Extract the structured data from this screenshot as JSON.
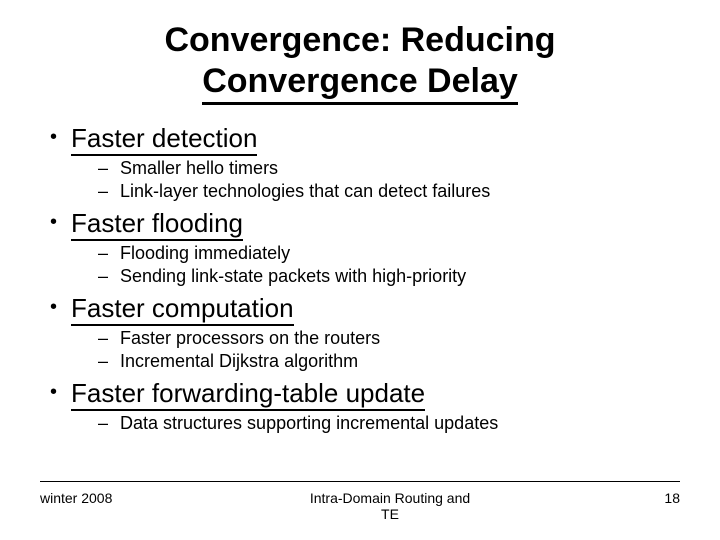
{
  "title_line1": "Convergence: Reducing",
  "title_line2": "Convergence Delay",
  "bullets": [
    {
      "main": "Faster detection",
      "subs": [
        "Smaller hello timers",
        "Link-layer technologies that can detect failures"
      ]
    },
    {
      "main": "Faster flooding",
      "subs": [
        "Flooding immediately",
        "Sending link-state packets with high-priority"
      ]
    },
    {
      "main": "Faster computation",
      "subs": [
        "Faster processors on the routers",
        "Incremental Dijkstra algorithm"
      ]
    },
    {
      "main": "Faster forwarding-table update",
      "subs": [
        "Data structures supporting incremental updates"
      ]
    }
  ],
  "footer_left": "winter 2008",
  "footer_center_line1": "Intra-Domain Routing and",
  "footer_center_line2": "TE",
  "footer_right": "18"
}
